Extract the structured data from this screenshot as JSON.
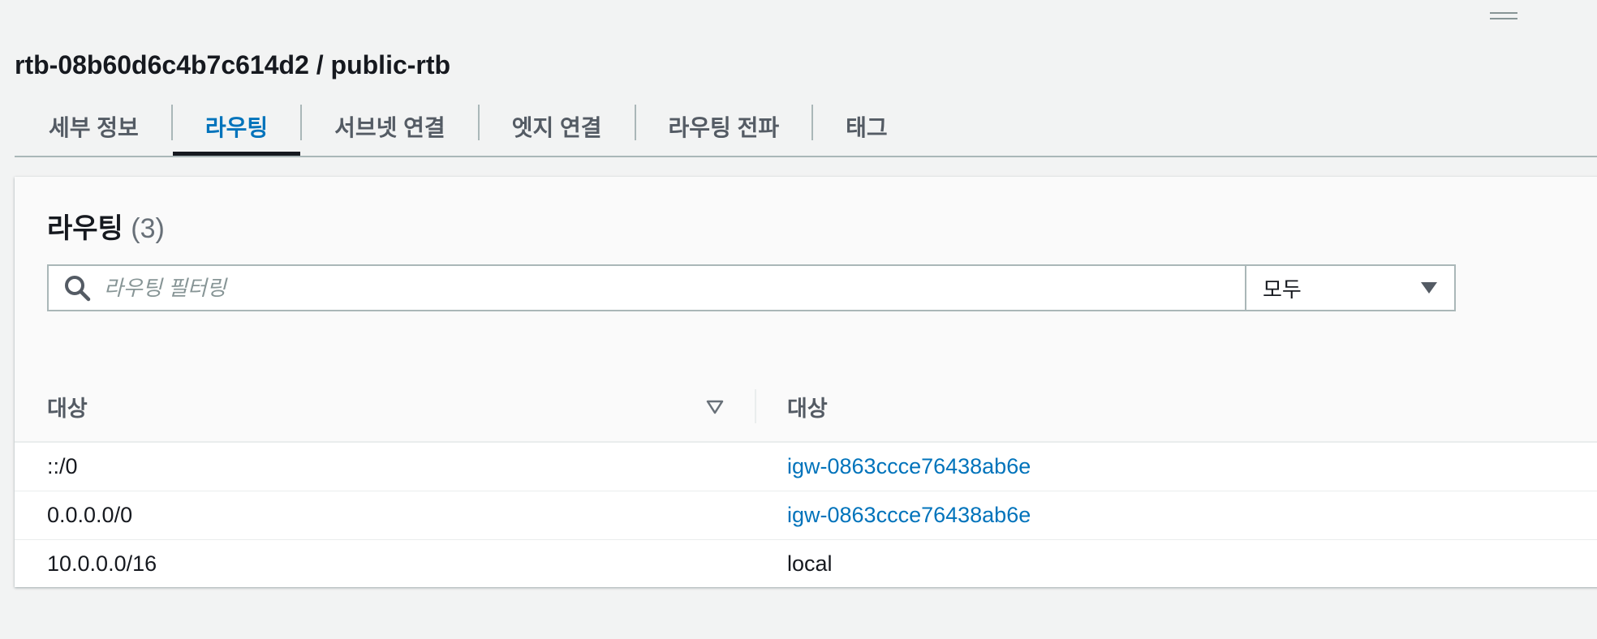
{
  "page": {
    "title": "rtb-08b60d6c4b7c614d2 / public-rtb"
  },
  "tabs": [
    {
      "label": "세부 정보",
      "active": false
    },
    {
      "label": "라우팅",
      "active": true
    },
    {
      "label": "서브넷 연결",
      "active": false
    },
    {
      "label": "엣지 연결",
      "active": false
    },
    {
      "label": "라우팅 전파",
      "active": false
    },
    {
      "label": "태그",
      "active": false
    }
  ],
  "routes_panel": {
    "title": "라우팅",
    "count": "(3)",
    "search": {
      "placeholder": "라우팅 필터링",
      "value": ""
    },
    "filter_select": {
      "value": "모두"
    },
    "columns": [
      "대상",
      "대상"
    ],
    "rows": [
      {
        "destination": "::/0",
        "target": "igw-0863ccce76438ab6e",
        "target_is_link": true
      },
      {
        "destination": "0.0.0.0/0",
        "target": "igw-0863ccce76438ab6e",
        "target_is_link": true
      },
      {
        "destination": "10.0.0.0/16",
        "target": "local",
        "target_is_link": false
      }
    ]
  },
  "colors": {
    "accent": "#0073bb",
    "background": "#f2f3f3",
    "text": "#16191f"
  }
}
